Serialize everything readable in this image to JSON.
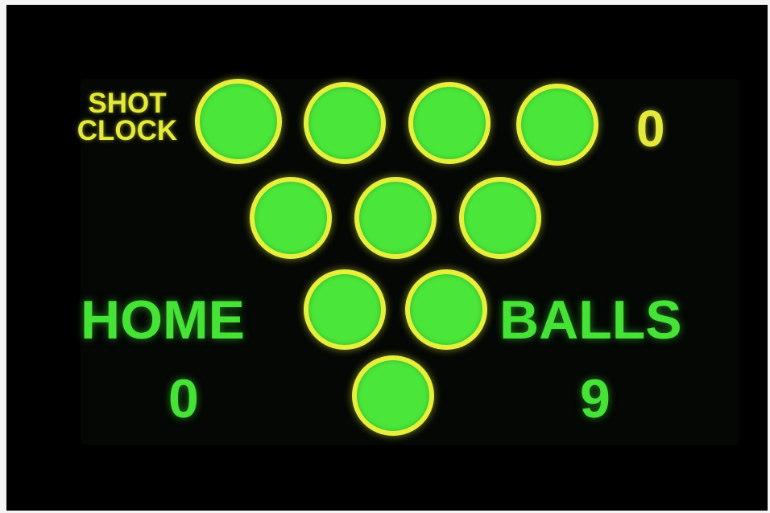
{
  "shot_clock": {
    "label_line1": "SHOT",
    "label_line2": "CLOCK",
    "value": "0"
  },
  "home": {
    "label": "HOME",
    "score": "0"
  },
  "balls": {
    "label": "BALLS",
    "count": "9"
  },
  "ball_rack": {
    "rows": [
      4,
      3,
      2,
      1
    ],
    "total": 10,
    "fill_color": "#4be63a",
    "ring_color": "#e6f03a"
  },
  "colors": {
    "shot_clock_text": "#e4ea3a",
    "score_text": "#44e336",
    "background": "#000000"
  }
}
